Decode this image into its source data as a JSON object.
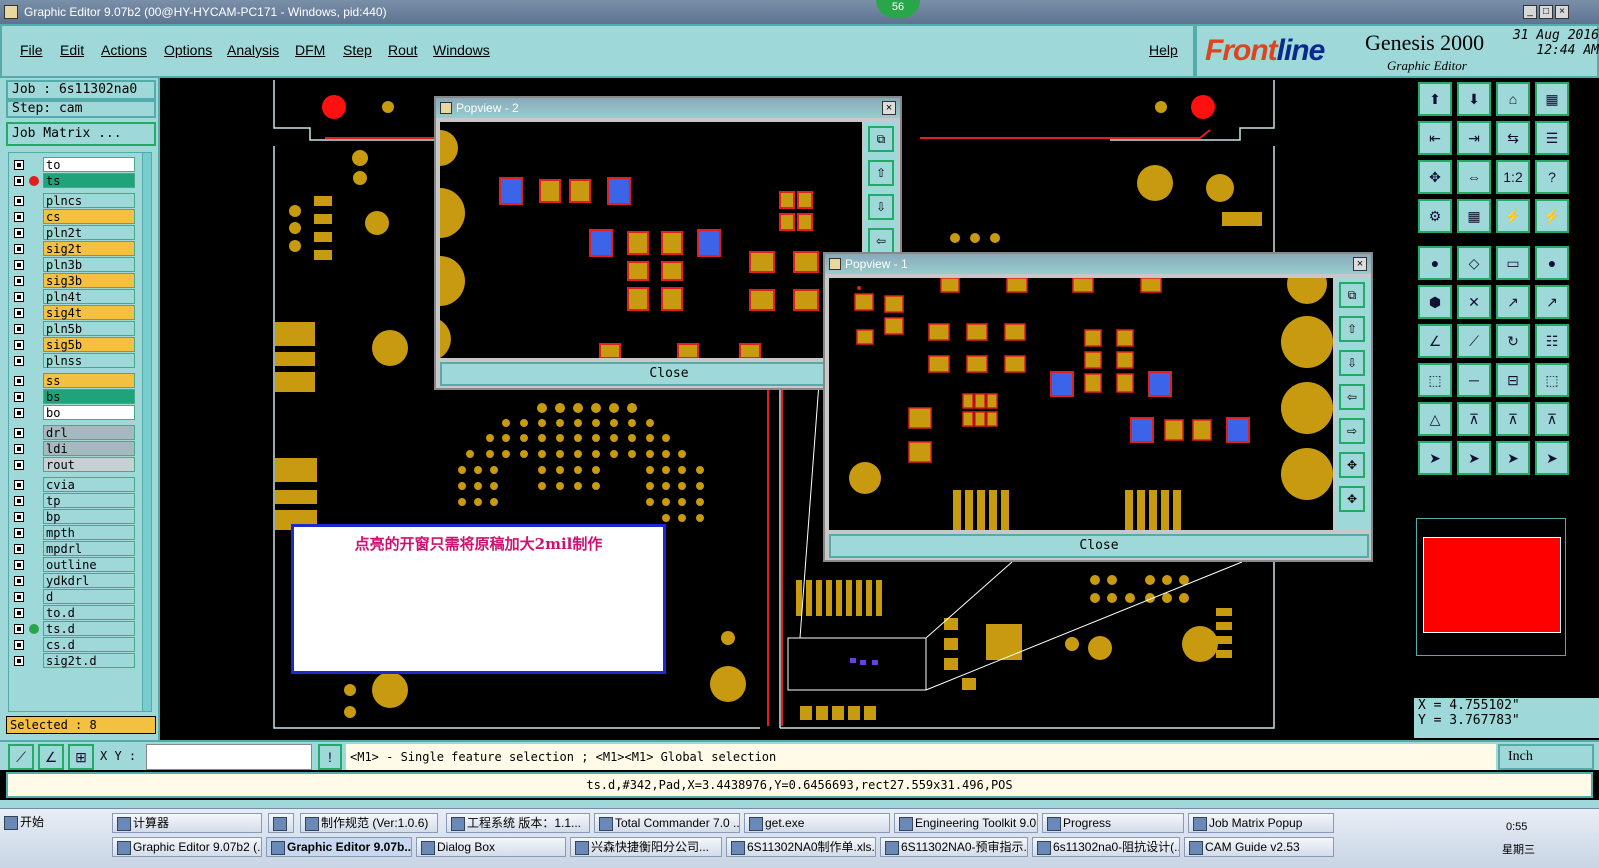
{
  "window": {
    "title": "Graphic Editor 9.07b2 (00@HY-HYCAM-PC171 - Windows, pid:440)",
    "badge": "56"
  },
  "menu": {
    "items": [
      "File",
      "Edit",
      "Actions",
      "Options",
      "Analysis",
      "DFM",
      "Step",
      "Rout",
      "Windows"
    ],
    "help": "Help"
  },
  "brand": {
    "logo_prefix": "Front",
    "logo_suffix": "line",
    "product": "Genesis 2000",
    "subtitle": "Graphic Editor",
    "date": "31 Aug 2016",
    "time": "12:44 AM"
  },
  "job": {
    "job_label": "Job : 6s11302na0",
    "step_label": "Step: cam",
    "matrix_button": "Job Matrix ..."
  },
  "layers": [
    {
      "name": "to",
      "color": "#ffffff",
      "mark": ""
    },
    {
      "name": "ts",
      "color": "#1fa37a",
      "mark": "#e02020"
    },
    {
      "name": "plncs",
      "color": "#9ed8d8",
      "mark": ""
    },
    {
      "name": "cs",
      "color": "#f4c040",
      "mark": ""
    },
    {
      "name": "pln2t",
      "color": "#9ed8d8",
      "mark": ""
    },
    {
      "name": "sig2t",
      "color": "#f4c040",
      "mark": ""
    },
    {
      "name": "pln3b",
      "color": "#9ed8d8",
      "mark": ""
    },
    {
      "name": "sig3b",
      "color": "#f4c040",
      "mark": ""
    },
    {
      "name": "pln4t",
      "color": "#9ed8d8",
      "mark": ""
    },
    {
      "name": "sig4t",
      "color": "#f4c040",
      "mark": ""
    },
    {
      "name": "pln5b",
      "color": "#9ed8d8",
      "mark": ""
    },
    {
      "name": "sig5b",
      "color": "#f4c040",
      "mark": ""
    },
    {
      "name": "plnss",
      "color": "#9ed8d8",
      "mark": ""
    },
    {
      "name": "ss",
      "color": "#f4c040",
      "mark": ""
    },
    {
      "name": "bs",
      "color": "#1fa37a",
      "mark": ""
    },
    {
      "name": "bo",
      "color": "#ffffff",
      "mark": ""
    },
    {
      "name": "drl",
      "color": "#a8b8c0",
      "mark": ""
    },
    {
      "name": "ldi",
      "color": "#a8b8c0",
      "mark": ""
    },
    {
      "name": "rout",
      "color": "#c8d0d4",
      "mark": ""
    },
    {
      "name": "cvia",
      "color": "#9ed8d8",
      "mark": ""
    },
    {
      "name": "tp",
      "color": "#9ed8d8",
      "mark": ""
    },
    {
      "name": "bp",
      "color": "#9ed8d8",
      "mark": ""
    },
    {
      "name": "mpth",
      "color": "#9ed8d8",
      "mark": ""
    },
    {
      "name": "mpdrl",
      "color": "#9ed8d8",
      "mark": ""
    },
    {
      "name": "outline",
      "color": "#9ed8d8",
      "mark": ""
    },
    {
      "name": "ydkdrl",
      "color": "#9ed8d8",
      "mark": ""
    },
    {
      "name": "d",
      "color": "#9ed8d8",
      "mark": ""
    },
    {
      "name": "to.d",
      "color": "#9ed8d8",
      "mark": ""
    },
    {
      "name": "ts.d",
      "color": "#9ed8d8",
      "mark": "#2aa64a"
    },
    {
      "name": "cs.d",
      "color": "#9ed8d8",
      "mark": ""
    },
    {
      "name": "sig2t.d",
      "color": "#9ed8d8",
      "mark": ""
    }
  ],
  "selected": "Selected : 8",
  "popview2": {
    "title": "Popview - 2",
    "close": "Close",
    "close_x": "×"
  },
  "popview1": {
    "title": "Popview - 1",
    "close": "Close",
    "close_x": "×"
  },
  "note": "点亮的开窗只需将原稿加大2mil制作",
  "coords": {
    "x": "X = 4.755102\"",
    "y": "Y = 3.767783\""
  },
  "cmd": {
    "xy_label": "X Y :",
    "xy_value": "",
    "prompt_icon": "!",
    "message": "<M1> - Single feature selection ; <M1><M1> Global selection",
    "unit": "Inch"
  },
  "status": "ts.d,#342,Pad,X=3.4438976,Y=0.6456693,rect27.559x31.496,POS",
  "taskbar": {
    "start": "开始",
    "row1": [
      "计算器",
      "",
      "制作规范 (Ver:1.0.6)",
      "工程系统  版本：1.1...",
      "Total Commander 7.0 ...",
      "get.exe",
      "Engineering Toolkit 9.0...",
      "Progress",
      "Job Matrix Popup"
    ],
    "row2": [
      "Graphic Editor 9.07b2 (...",
      "Graphic Editor 9.07b...",
      "Dialog Box",
      "兴森快捷衡阳分公司...",
      "6S11302NA0制作单.xls...",
      "6S11302NA0-预审指示...",
      "6s11302na0-阻抗设计(...",
      "CAM  Guide v2.53"
    ],
    "clock": "0:55",
    "weekday": "星期三"
  }
}
